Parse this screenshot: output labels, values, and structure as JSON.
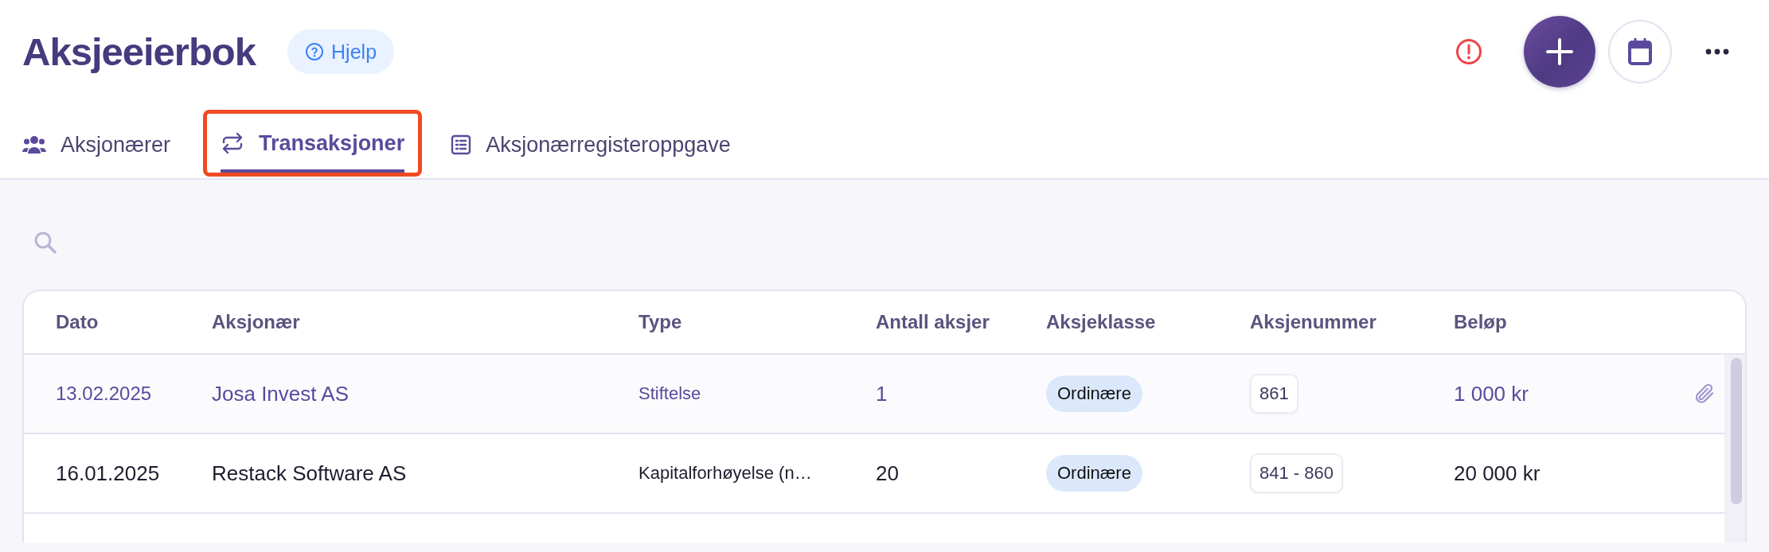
{
  "header": {
    "title": "Aksjeeierbok",
    "help_button": "Hjelp"
  },
  "tabs": [
    {
      "label": "Aksjonærer",
      "selected": false,
      "highlighted": false
    },
    {
      "label": "Transaksjoner",
      "selected": true,
      "highlighted": true
    },
    {
      "label": "Aksjonærregisteroppgave",
      "selected": false,
      "highlighted": false
    }
  ],
  "table": {
    "columns": [
      "Dato",
      "Aksjonær",
      "Type",
      "Antall aksjer",
      "Aksjeklasse",
      "Aksjenummer",
      "Beløp"
    ],
    "rows": [
      {
        "selected": true,
        "date": "13.02.2025",
        "shareholder": "Josa Invest AS",
        "type": "Stiftelse",
        "shares": "1",
        "share_class": "Ordinære",
        "share_numbers": "861",
        "amount": "1 000 kr",
        "has_attachment": true
      },
      {
        "selected": false,
        "date": "16.01.2025",
        "shareholder": "Restack Software AS",
        "type": "Kapitalforhøyelse (n…",
        "shares": "20",
        "share_class": "Ordinære",
        "share_numbers": "841 - 860",
        "amount": "20 000 kr",
        "has_attachment": false
      }
    ]
  }
}
